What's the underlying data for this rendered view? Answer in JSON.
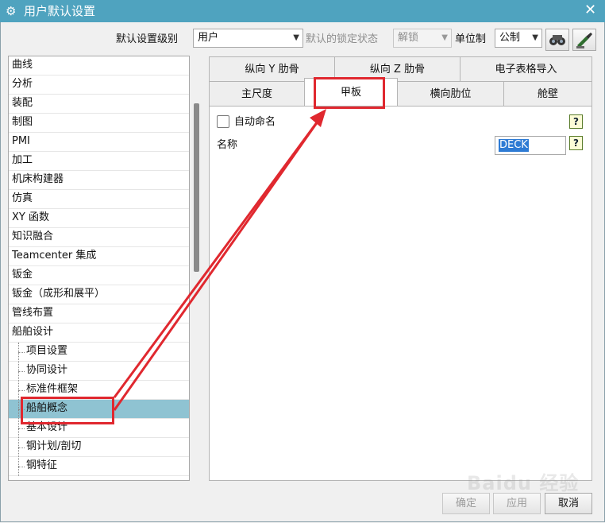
{
  "window": {
    "title": "用户默认设置",
    "close_glyph": "✕",
    "gear_glyph": "⚙"
  },
  "toolbar": {
    "level_label": "默认设置级别",
    "level_value": "用户",
    "lock_label": "默认的锁定状态",
    "lock_value": "解锁",
    "unit_label": "单位制",
    "unit_value": "公制",
    "dropdown_glyph": "▼"
  },
  "tree": {
    "items": [
      {
        "label": "曲线"
      },
      {
        "label": "分析"
      },
      {
        "label": "装配"
      },
      {
        "label": "制图"
      },
      {
        "label": "PMI"
      },
      {
        "label": "加工"
      },
      {
        "label": "机床构建器"
      },
      {
        "label": "仿真"
      },
      {
        "label": "XY 函数"
      },
      {
        "label": "知识融合"
      },
      {
        "label": "Teamcenter 集成"
      },
      {
        "label": "钣金"
      },
      {
        "label": "钣金（成形和展平）"
      },
      {
        "label": "管线布置"
      },
      {
        "label": "船舶设计"
      }
    ],
    "children": [
      {
        "label": "项目设置"
      },
      {
        "label": "协同设计"
      },
      {
        "label": "标准件框架"
      },
      {
        "label": "船舶概念",
        "selected": true
      },
      {
        "label": "基本设计"
      },
      {
        "label": "钢计划/剖切"
      },
      {
        "label": "钢特征"
      }
    ]
  },
  "tabs": {
    "row_top": [
      {
        "label": "纵向 Y 肋骨"
      },
      {
        "label": "纵向 Z 肋骨"
      },
      {
        "label": "电子表格导入"
      }
    ],
    "row_bottom": [
      {
        "label": "主尺度"
      },
      {
        "label": "甲板",
        "active": true
      },
      {
        "label": "横向肋位"
      },
      {
        "label": "舱壁"
      }
    ]
  },
  "deck_panel": {
    "auto_name_label": "自动命名",
    "name_label": "名称",
    "name_value": "DECK",
    "help_glyph": "?"
  },
  "footer": {
    "ok_label": "确定",
    "apply_label": "应用",
    "cancel_label": "取消"
  },
  "watermark": {
    "text": "Baidu 经验"
  },
  "colors": {
    "titlebar": "#4fa3bf",
    "selection": "#8fc3d2",
    "annotation": "#e0282f"
  }
}
